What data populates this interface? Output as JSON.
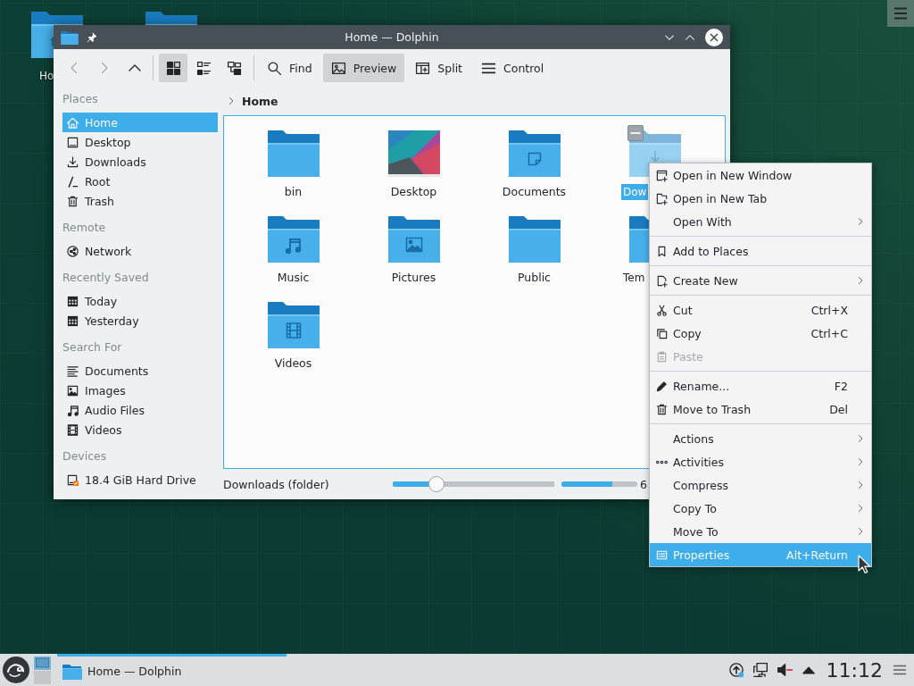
{
  "desktop": {
    "icons": [
      {
        "kind": "home",
        "label": "Ho"
      },
      {
        "kind": "folder"
      }
    ]
  },
  "window": {
    "title": "Home — Dolphin",
    "toolbar": {
      "navigation": [
        {
          "kind": "back",
          "disabled": true
        },
        {
          "kind": "forward",
          "disabled": true
        },
        {
          "kind": "up",
          "disabled": false
        }
      ],
      "view_modes": [
        {
          "kind": "icons",
          "selected": true
        },
        {
          "kind": "compact",
          "selected": false
        },
        {
          "kind": "details",
          "selected": false
        }
      ],
      "actions": [
        {
          "kind": "search",
          "label": "Find",
          "checked": false
        },
        {
          "kind": "preview",
          "label": "Preview",
          "checked": true
        },
        {
          "kind": "split",
          "label": "Split",
          "checked": false
        },
        {
          "kind": "menu",
          "label": "Control",
          "checked": false
        }
      ]
    },
    "sidebar": {
      "sections": [
        {
          "title": "Places",
          "items": [
            {
              "kind": "home",
              "label": "Home",
              "selected": true
            },
            {
              "kind": "desktop",
              "label": "Desktop",
              "selected": false
            },
            {
              "kind": "downloads",
              "label": "Downloads",
              "selected": false
            },
            {
              "kind": "root",
              "label": "Root",
              "selected": false
            },
            {
              "kind": "trash",
              "label": "Trash",
              "selected": false
            }
          ]
        },
        {
          "title": "Remote",
          "items": [
            {
              "kind": "network",
              "label": "Network",
              "selected": false
            }
          ]
        },
        {
          "title": "Recently Saved",
          "items": [
            {
              "kind": "calendar",
              "label": "Today",
              "selected": false
            },
            {
              "kind": "calendar",
              "label": "Yesterday",
              "selected": false
            }
          ]
        },
        {
          "title": "Search For",
          "items": [
            {
              "kind": "documents",
              "label": "Documents",
              "selected": false
            },
            {
              "kind": "images",
              "label": "Images",
              "selected": false
            },
            {
              "kind": "audio",
              "label": "Audio Files",
              "selected": false
            },
            {
              "kind": "videos",
              "label": "Videos",
              "selected": false
            }
          ]
        },
        {
          "title": "Devices",
          "items": [
            {
              "kind": "drive",
              "label": "18.4 GiB Hard Drive",
              "selected": false
            }
          ]
        }
      ]
    },
    "breadcrumb": [
      "Home"
    ],
    "files": [
      {
        "kind": "folder",
        "name": "bin",
        "selected": false
      },
      {
        "kind": "image",
        "name": "Desktop",
        "selected": false
      },
      {
        "kind": "documents",
        "name": "Documents",
        "selected": false
      },
      {
        "kind": "downloads",
        "name": "Dow",
        "selected": true
      },
      {
        "kind": "music",
        "name": "Music",
        "selected": false
      },
      {
        "kind": "pictures",
        "name": "Pictures",
        "selected": false
      },
      {
        "kind": "folder",
        "name": "Public",
        "selected": false
      },
      {
        "kind": "folder",
        "name": "Tem",
        "selected": false
      },
      {
        "kind": "videos",
        "name": "Videos",
        "selected": false
      }
    ],
    "status_bar": {
      "text": "Downloads (folder)",
      "zoom": {
        "level": 0.27
      },
      "free_space": {
        "level": 0.67,
        "text": "6"
      }
    }
  },
  "context_menu": {
    "sections": [
      {
        "items": [
          {
            "kind": "new-window",
            "label": "Open in New Window",
            "submenu": false,
            "disabled": false,
            "selected": false
          },
          {
            "kind": "new-tab",
            "label": "Open in New Tab",
            "submenu": false,
            "disabled": false,
            "selected": false
          },
          {
            "kind": "plain",
            "label": "Open With",
            "submenu": true,
            "disabled": false,
            "selected": false
          }
        ]
      },
      {
        "items": [
          {
            "kind": "bookmark",
            "label": "Add to Places",
            "submenu": false,
            "disabled": false,
            "selected": false
          }
        ]
      },
      {
        "items": [
          {
            "kind": "new-file",
            "label": "Create New",
            "submenu": true,
            "disabled": false,
            "selected": false
          }
        ]
      },
      {
        "items": [
          {
            "kind": "cut",
            "label": "Cut",
            "shortcut": "Ctrl+X",
            "submenu": false,
            "disabled": false,
            "selected": false
          },
          {
            "kind": "copy",
            "label": "Copy",
            "shortcut": "Ctrl+C",
            "submenu": false,
            "disabled": false,
            "selected": false
          },
          {
            "kind": "paste",
            "label": "Paste",
            "submenu": false,
            "disabled": true,
            "selected": false
          }
        ]
      },
      {
        "items": [
          {
            "kind": "rename",
            "label": "Rename...",
            "shortcut": "F2",
            "submenu": false,
            "disabled": false,
            "selected": false
          },
          {
            "kind": "trash",
            "label": "Move to Trash",
            "shortcut": "Del",
            "submenu": false,
            "disabled": false,
            "selected": false
          }
        ]
      },
      {
        "items": [
          {
            "kind": "plain",
            "label": "Actions",
            "submenu": true,
            "disabled": false,
            "selected": false
          },
          {
            "kind": "activities",
            "label": "Activities",
            "submenu": true,
            "disabled": false,
            "selected": false
          },
          {
            "kind": "plain",
            "label": "Compress",
            "submenu": true,
            "disabled": false,
            "selected": false
          },
          {
            "kind": "plain",
            "label": "Copy To",
            "submenu": true,
            "disabled": false,
            "selected": false
          },
          {
            "kind": "plain",
            "label": "Move To",
            "submenu": true,
            "disabled": false,
            "selected": false
          },
          {
            "kind": "properties",
            "label": "Properties",
            "shortcut": "Alt+Return",
            "submenu": false,
            "disabled": false,
            "selected": true
          }
        ]
      }
    ]
  },
  "taskbar": {
    "pager": [
      {
        "selected": true
      },
      {
        "selected": false
      }
    ],
    "tasks": [
      {
        "title": "Home — Dolphin",
        "selected": true
      }
    ],
    "tray": [
      {
        "kind": "updates"
      },
      {
        "kind": "network"
      },
      {
        "kind": "volume-muted"
      },
      {
        "kind": "expand"
      }
    ],
    "clock": "11:12"
  }
}
